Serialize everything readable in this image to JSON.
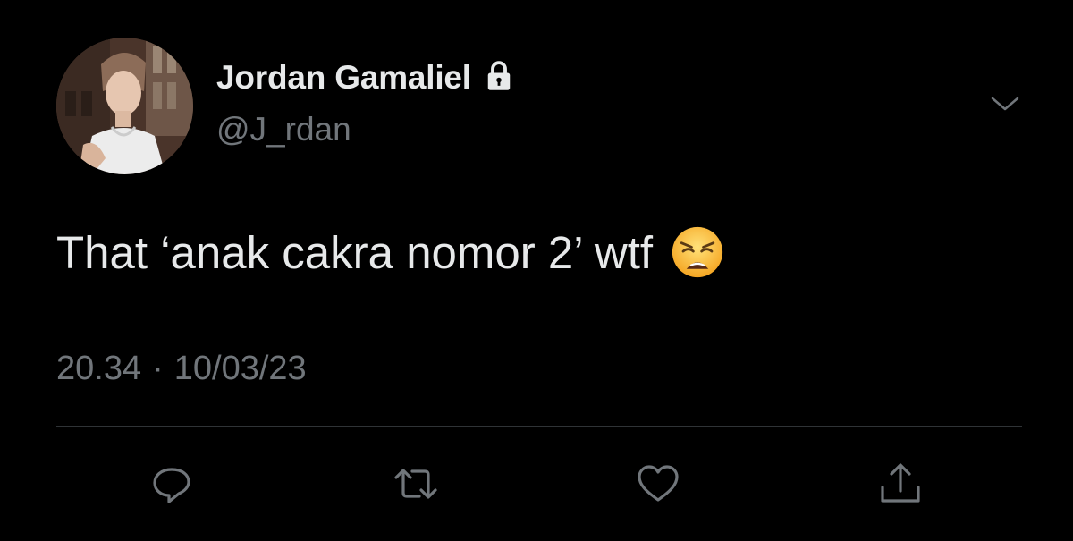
{
  "tweet": {
    "author": {
      "display_name": "Jordan Gamaliel",
      "handle": "@J_rdan",
      "protected_icon": "lock-icon",
      "avatar": "profile-photo"
    },
    "text": "That ‘anak cakra nomor 2’ wtf",
    "emoji": "weary-face-emoji",
    "time": "20.34",
    "separator": "·",
    "date": "10/03/23"
  },
  "actions": [
    {
      "icon": "reply-icon"
    },
    {
      "icon": "retweet-icon"
    },
    {
      "icon": "like-icon"
    },
    {
      "icon": "share-icon"
    }
  ],
  "colors": {
    "background": "#000000",
    "primary_text": "#e7e9ea",
    "secondary_text": "#71767b",
    "divider": "#2f3336"
  }
}
